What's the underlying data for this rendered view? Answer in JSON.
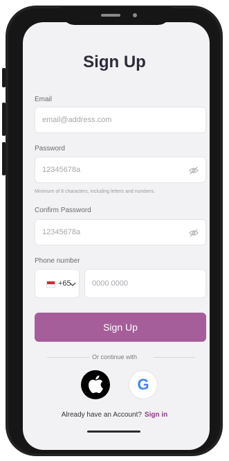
{
  "title": "Sign Up",
  "email": {
    "label": "Email",
    "placeholder": "email@address.com"
  },
  "password": {
    "label": "Password",
    "placeholder": "12345678a",
    "hint": "Minimum of 8 characters, including letters and numbers."
  },
  "confirm_password": {
    "label": "Confirm Password",
    "placeholder": "12345678a"
  },
  "phone": {
    "label": "Phone number",
    "country_code": "+65",
    "placeholder": "0000 0000"
  },
  "buttons": {
    "sign_up": "Sign Up"
  },
  "divider_text": "Or continue with",
  "social": {
    "apple": "apple-logo",
    "google": "G"
  },
  "footer": {
    "prompt": "Already have an Account?",
    "sign_in": "Sign in"
  },
  "colors": {
    "primary": "#a55e9a",
    "link": "#8e3b87",
    "screen_bg": "#f2f1f3"
  }
}
